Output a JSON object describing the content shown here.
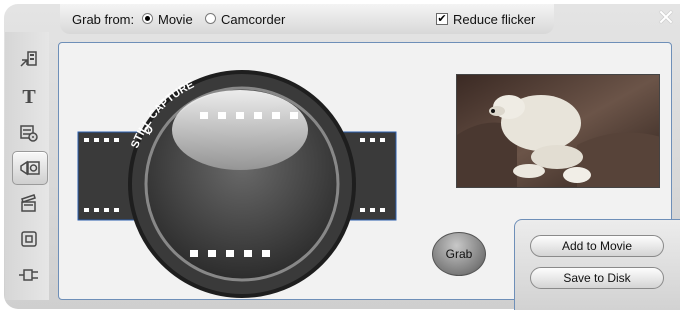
{
  "topbar": {
    "grab_from_label": "Grab from:",
    "source_options": [
      {
        "label": "Movie",
        "selected": true
      },
      {
        "label": "Camcorder",
        "selected": false
      }
    ],
    "reduce_flicker_label": "Reduce flicker",
    "reduce_flicker_checked": true,
    "checkmark": "✔"
  },
  "close_glyph": "✕",
  "lens": {
    "ring_text": "STILL CAPTURE",
    "ring_symbol": "Ø"
  },
  "actions": {
    "grab_label": "Grab",
    "add_to_movie_label": "Add to Movie",
    "save_to_disk_label": "Save to Disk"
  },
  "sidebar": {
    "items": [
      {
        "icon": "movie-tools-icon",
        "active": false
      },
      {
        "icon": "title-text-icon",
        "glyph": "T",
        "active": false
      },
      {
        "icon": "disc-menu-icon",
        "active": false
      },
      {
        "icon": "frame-grab-icon",
        "active": true
      },
      {
        "icon": "clapper-icon",
        "active": false
      },
      {
        "icon": "square-icon",
        "active": false
      },
      {
        "icon": "plugin-icon",
        "active": false
      }
    ]
  },
  "colors": {
    "accent_border": "#6e8fb8",
    "panel_bg": "#f2f2f2"
  }
}
